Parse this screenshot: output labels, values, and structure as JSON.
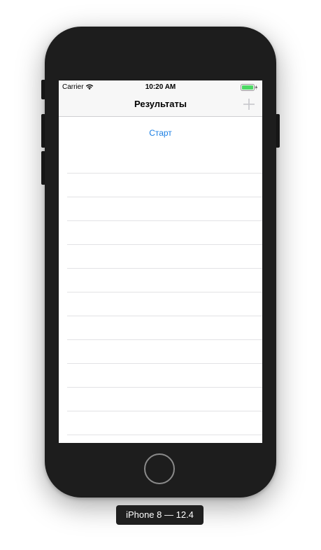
{
  "status_bar": {
    "carrier": "Carrier",
    "time": "10:20 AM",
    "wifi_icon": "wifi-icon",
    "battery_icon": "battery-icon",
    "battery_color": "#4cd964"
  },
  "nav_bar": {
    "title": "Результаты",
    "add_icon": "plus-icon"
  },
  "content": {
    "start_label": "Старт",
    "accent_color": "#1a7ee3",
    "rows": [
      "",
      "",
      "",
      "",
      "",
      "",
      "",
      "",
      "",
      "",
      "",
      ""
    ]
  },
  "device": {
    "label": "iPhone 8 — 12.4"
  }
}
